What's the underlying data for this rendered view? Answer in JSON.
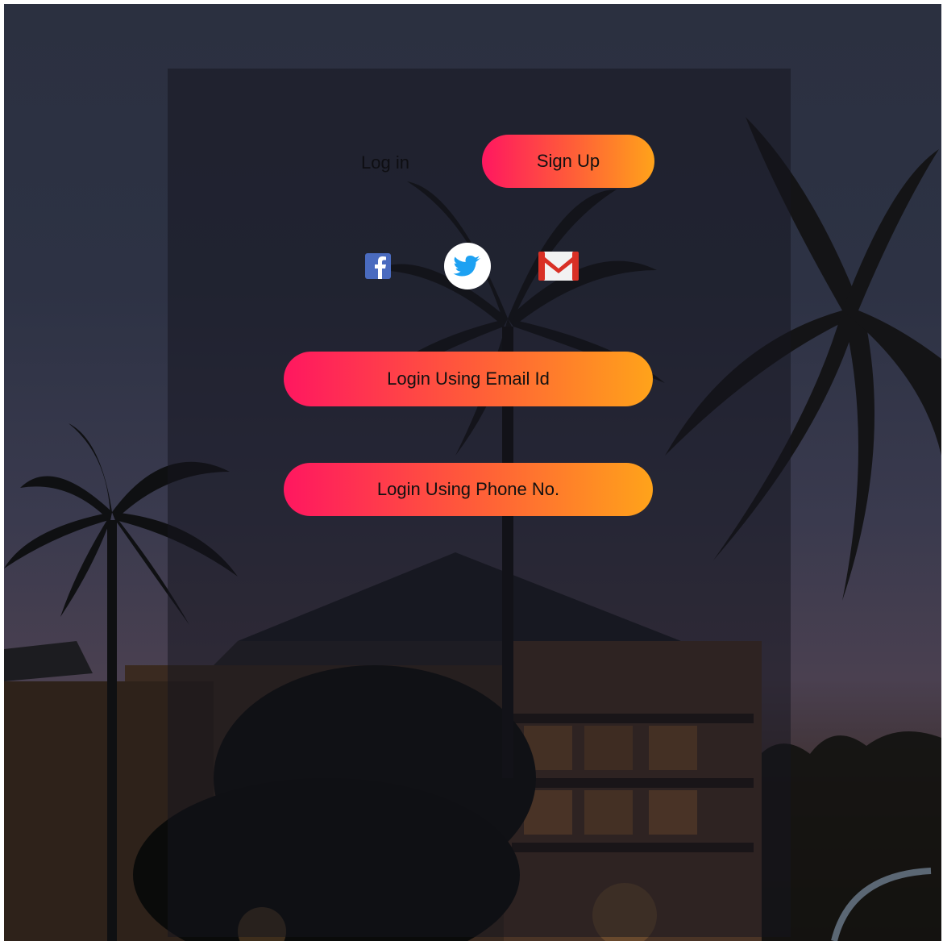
{
  "tabs": {
    "login_label": "Log in",
    "signup_label": "Sign Up"
  },
  "social": [
    {
      "name": "facebook",
      "icon": "facebook-icon",
      "color": "#4a6bbf"
    },
    {
      "name": "twitter",
      "icon": "twitter-icon",
      "color": "#1da1f2"
    },
    {
      "name": "gmail",
      "icon": "gmail-icon",
      "color": "#d93025"
    }
  ],
  "actions": {
    "email_login_label": "Login Using Email Id",
    "phone_login_label": "Login Using Phone No."
  },
  "colors": {
    "gradient_start": "#ff1760",
    "gradient_mid": "#ff5a3a",
    "gradient_end": "#ffa31a",
    "panel_overlay": "rgba(22,22,30,0.52)"
  }
}
